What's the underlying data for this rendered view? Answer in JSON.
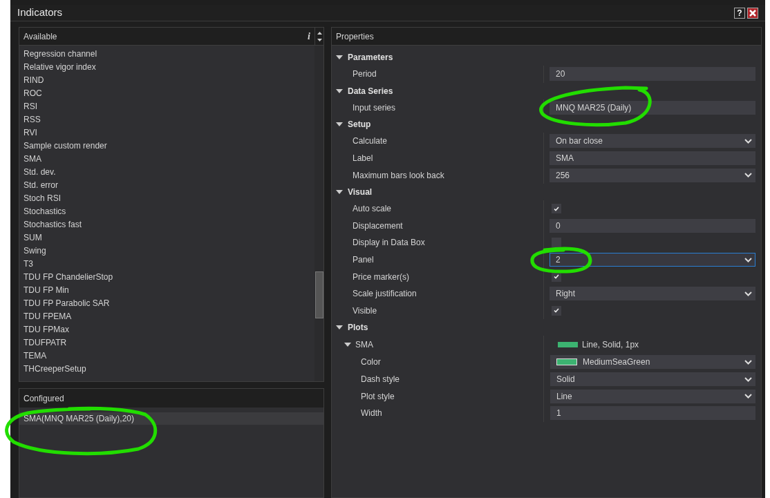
{
  "window": {
    "title": "Indicators",
    "help_button": "?"
  },
  "available": {
    "header": "Available",
    "info": "i",
    "items": [
      {
        "label": "Regression channel"
      },
      {
        "label": "Relative vigor index"
      },
      {
        "label": "RIND"
      },
      {
        "label": "ROC"
      },
      {
        "label": "RSI"
      },
      {
        "label": "RSS"
      },
      {
        "label": "RVI"
      },
      {
        "label": "Sample custom render"
      },
      {
        "label": "SMA"
      },
      {
        "label": "Std. dev."
      },
      {
        "label": "Std. error"
      },
      {
        "label": "Stoch RSI"
      },
      {
        "label": "Stochastics"
      },
      {
        "label": "Stochastics fast"
      },
      {
        "label": "SUM"
      },
      {
        "label": "Swing"
      },
      {
        "label": "T3"
      },
      {
        "label": "TDU FP ChandelierStop"
      },
      {
        "label": "TDU FP Min"
      },
      {
        "label": "TDU FP Parabolic SAR"
      },
      {
        "label": "TDU FPEMA"
      },
      {
        "label": "TDU FPMax"
      },
      {
        "label": "TDUFPATR"
      },
      {
        "label": "TEMA"
      },
      {
        "label": "THCreeperSetup"
      }
    ]
  },
  "configured": {
    "header": "Configured",
    "items": [
      {
        "label": "SMA(MNQ MAR25 (Daily),20)",
        "selected": true
      }
    ]
  },
  "properties": {
    "header": "Properties",
    "sections": [
      {
        "title": "Parameters",
        "expanded": true,
        "rows": [
          {
            "label": "Period",
            "kind": "text",
            "value": "20",
            "focused": false
          }
        ]
      },
      {
        "title": "Data Series",
        "expanded": true,
        "rows": [
          {
            "label": "Input series",
            "kind": "text",
            "value": "MNQ MAR25 (Daily)",
            "focused": false
          }
        ]
      },
      {
        "title": "Setup",
        "expanded": true,
        "rows": [
          {
            "label": "Calculate",
            "kind": "select",
            "value": "On bar close",
            "focused": false
          },
          {
            "label": "Label",
            "kind": "text",
            "value": "SMA",
            "focused": false
          },
          {
            "label": "Maximum bars look back",
            "kind": "select",
            "value": "256",
            "focused": false
          }
        ]
      },
      {
        "title": "Visual",
        "expanded": true,
        "rows": [
          {
            "label": "Auto scale",
            "kind": "checkbox",
            "checked": true
          },
          {
            "label": "Displacement",
            "kind": "text",
            "value": "0",
            "focused": false
          },
          {
            "label": "Display in Data Box",
            "kind": "checkbox",
            "checked": false
          },
          {
            "label": "Panel",
            "kind": "select",
            "value": "2",
            "focused": true
          },
          {
            "label": "Price marker(s)",
            "kind": "checkbox",
            "checked": true
          },
          {
            "label": "Scale justification",
            "kind": "select",
            "value": "Right",
            "focused": false
          },
          {
            "label": "Visible",
            "kind": "checkbox",
            "checked": true
          }
        ]
      },
      {
        "title": "Plots",
        "expanded": true,
        "rows": [
          {
            "label": "SMA",
            "kind": "group",
            "expanded": true,
            "summary": "Line, Solid, 1px",
            "color": "#3cb371",
            "children": [
              {
                "label": "Color",
                "kind": "color-select",
                "value": "MediumSeaGreen",
                "color": "#3cb371",
                "focused": false
              },
              {
                "label": "Dash style",
                "kind": "select",
                "value": "Solid",
                "focused": false
              },
              {
                "label": "Plot style",
                "kind": "select",
                "value": "Line",
                "focused": false
              },
              {
                "label": "Width",
                "kind": "text",
                "value": "1",
                "focused": false
              }
            ]
          }
        ]
      }
    ]
  }
}
